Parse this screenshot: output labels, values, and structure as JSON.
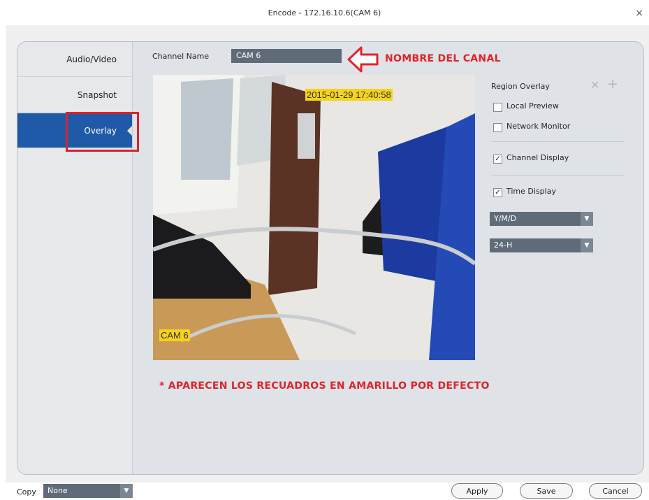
{
  "window": {
    "title": "Encode - 172.16.10.6(CAM 6)",
    "close_icon": "×"
  },
  "sidebar": {
    "items": [
      {
        "label": "Audio/Video"
      },
      {
        "label": "Snapshot"
      },
      {
        "label": "Overlay"
      }
    ]
  },
  "channel": {
    "label": "Channel Name",
    "value": "CAM 6"
  },
  "annotations": {
    "channel_name": "NOMBRE DEL CANAL",
    "note": "* APARECEN LOS RECUADROS EN AMARILLO POR DEFECTO"
  },
  "preview": {
    "timestamp": "2015-01-29 17:40:58",
    "channel_tag": "CAM 6"
  },
  "overlay_panel": {
    "region_overlay": "Region Overlay",
    "local_preview": {
      "label": "Local Preview",
      "checked": false
    },
    "network_monitor": {
      "label": "Network Monitor",
      "checked": false
    },
    "channel_display": {
      "label": "Channel Display",
      "checked": true
    },
    "time_display": {
      "label": "Time Display",
      "checked": true
    },
    "date_format": "Y/M/D",
    "time_format": "24-H"
  },
  "footer": {
    "copy_label": "Copy",
    "copy_value": "None",
    "apply": "Apply",
    "save": "Save",
    "cancel": "Cancel"
  },
  "colors": {
    "accent": "#1e5aa8",
    "field": "#5f6b78",
    "annotation": "#e0242a",
    "highlight": "#f6d21c"
  }
}
